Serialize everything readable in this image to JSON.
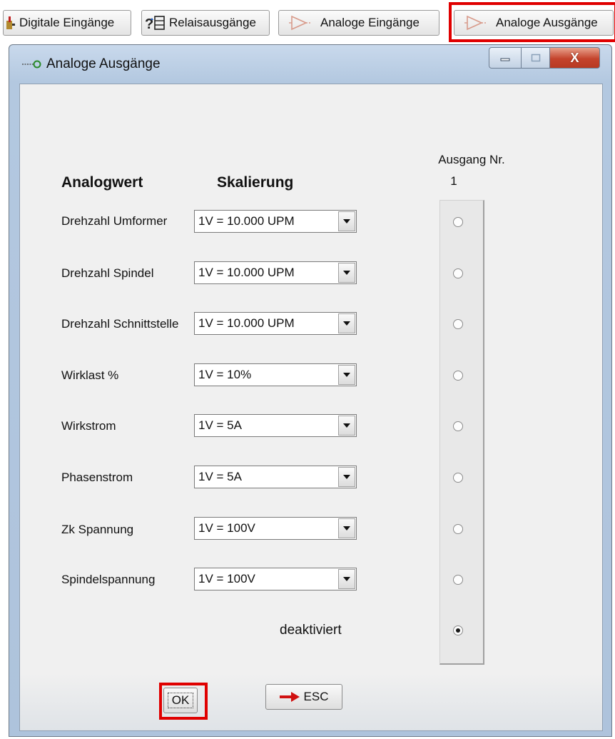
{
  "toolbar": {
    "buttons": [
      {
        "label": "Digitale Eingänge",
        "icon": "digital-input-icon"
      },
      {
        "label": "Relaisausgänge",
        "icon": "relay-output-icon"
      },
      {
        "label": "Analoge Eingänge",
        "icon": "analog-input-icon"
      },
      {
        "label": "Analoge Ausgänge",
        "icon": "analog-output-icon",
        "active": true
      }
    ]
  },
  "window": {
    "title": "Analoge Ausgänge",
    "controls": [
      "minimize",
      "maximize",
      "close"
    ],
    "close_glyph": "X"
  },
  "headers": {
    "analogwert": "Analogwert",
    "skalierung": "Skalierung",
    "ausgang": "Ausgang Nr.",
    "ausgang_num": "1"
  },
  "rows": [
    {
      "label": "Drehzahl Umformer",
      "scaling": "1V = 10.000 UPM",
      "selected": false
    },
    {
      "label": "Drehzahl Spindel",
      "scaling": "1V = 10.000 UPM",
      "selected": false
    },
    {
      "label": "Drehzahl Schnittstelle",
      "scaling": "1V = 10.000 UPM",
      "selected": false
    },
    {
      "label": "Wirklast %",
      "scaling": "1V = 10%",
      "selected": false
    },
    {
      "label": "Wirkstrom",
      "scaling": "1V = 5A",
      "selected": false
    },
    {
      "label": "Phasenstrom",
      "scaling": "1V = 5A",
      "selected": false
    },
    {
      "label": "Zk Spannung",
      "scaling": "1V = 100V",
      "selected": false
    },
    {
      "label": "Spindelspannung",
      "scaling": "1V = 100V",
      "selected": false
    }
  ],
  "deaktiviert": {
    "label": "deaktiviert",
    "selected": true
  },
  "buttons": {
    "ok": "OK",
    "esc": "ESC",
    "esc_icon": "red-arrow-right-icon"
  },
  "colors": {
    "highlight": "#e00000",
    "arrow": "#d01010"
  }
}
